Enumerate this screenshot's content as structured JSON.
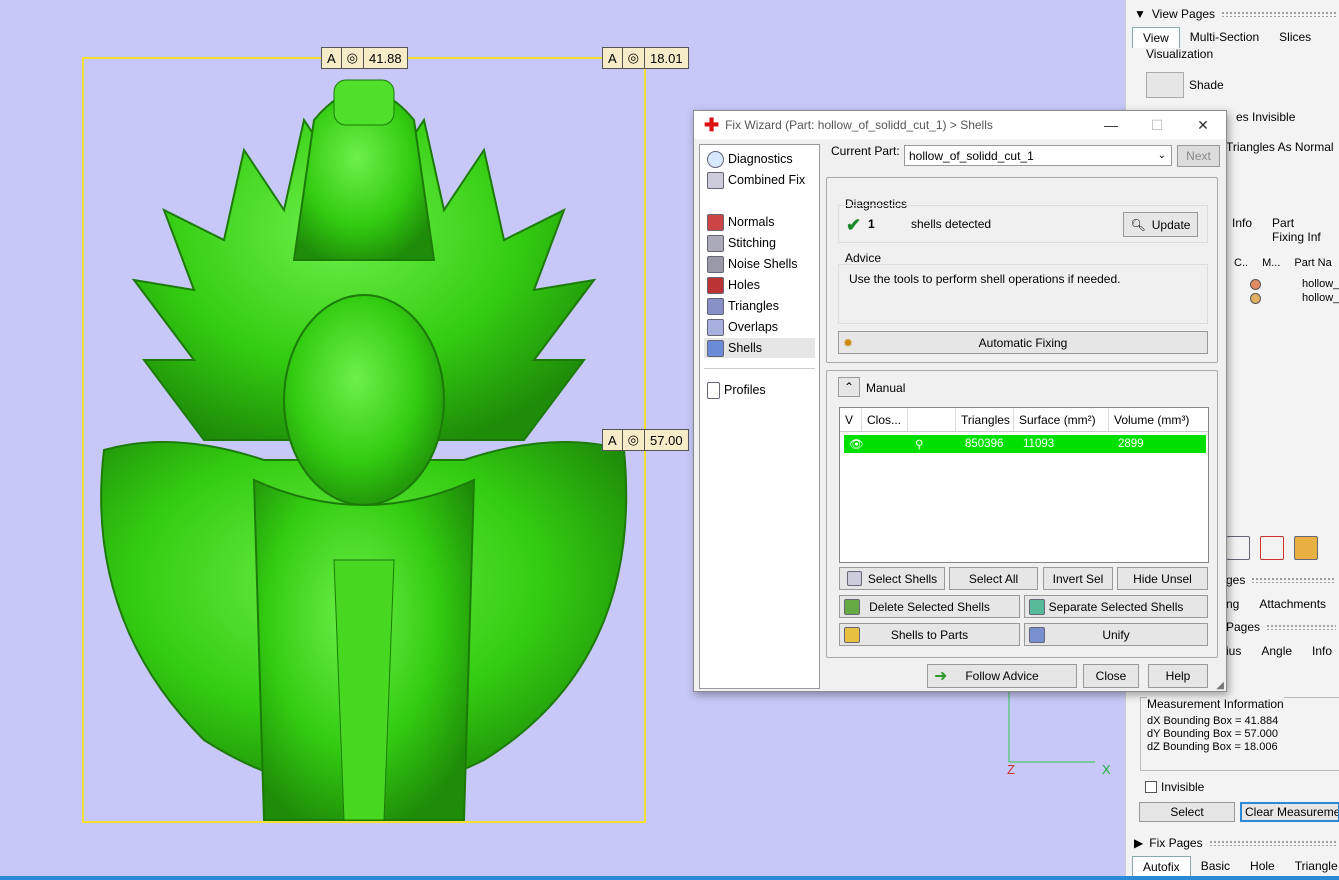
{
  "viewport": {
    "dim_labels": [
      {
        "axis": "A",
        "value": "41.88"
      },
      {
        "axis": "A",
        "value": "18.01"
      },
      {
        "axis": "A",
        "value": "57.00"
      }
    ],
    "axes": {
      "z": "Z",
      "x": "X"
    }
  },
  "right_panel": {
    "view_pages": {
      "title": "View Pages",
      "tabs": [
        "View",
        "Multi-Section",
        "Slices"
      ],
      "visualization_label": "Visualization",
      "shade_label": "Shade",
      "invisible_partial": "es Invisible",
      "triangles_partial": "Triangles As Normal"
    },
    "info_tabs": [
      "Info",
      "Part Fixing Inf"
    ],
    "part_list": {
      "headers": [
        "C..",
        "M...",
        "Part Na"
      ],
      "rows": [
        "hollow_",
        "hollow_"
      ]
    },
    "pages2": {
      "title_partial": "ges",
      "tabs": [
        "ng",
        "Attachments"
      ]
    },
    "measure_pages": {
      "title_partial": "Pages",
      "tabs": [
        "ius",
        "Angle",
        "Info"
      ]
    },
    "measurement": {
      "title": "Measurement Information",
      "lines": [
        "dX Bounding Box = 41.884",
        "dY Bounding Box = 57.000",
        "dZ Bounding Box = 18.006"
      ]
    },
    "invisible_checkbox": "Invisible",
    "select_button": "Select",
    "clear_button": "Clear Measurements",
    "fix_pages": {
      "title": "Fix Pages",
      "tabs": [
        "Autofix",
        "Basic",
        "Hole",
        "Triangle"
      ]
    }
  },
  "dialog": {
    "title": "Fix Wizard (Part: hollow_of_solidd_cut_1) > Shells",
    "nav": {
      "group1": [
        "Diagnostics",
        "Combined Fix"
      ],
      "group2": [
        "Normals",
        "Stitching",
        "Noise Shells",
        "Holes",
        "Triangles",
        "Overlaps",
        "Shells"
      ],
      "group3": [
        "Profiles"
      ],
      "selected": "Shells"
    },
    "current_part_label": "Current Part:",
    "current_part_value": "hollow_of_solidd_cut_1",
    "next_button": "Next",
    "diagnostics": {
      "title": "Diagnostics",
      "count": "1",
      "text": "shells detected",
      "update_button": "Update"
    },
    "advice": {
      "title": "Advice",
      "text": "Use the tools to perform shell operations if needed."
    },
    "automatic_fixing_button": "Automatic Fixing",
    "manual": {
      "title": "Manual",
      "columns": [
        "V",
        "Clos...",
        "",
        "Triangles",
        "Surface (mm²)",
        "Volume (mm³)"
      ],
      "rows": [
        {
          "triangles": "850396",
          "surface": "11093",
          "volume": "2899"
        }
      ]
    },
    "buttons": {
      "select_shells": "Select Shells",
      "select_all": "Select All",
      "invert_sel": "Invert Sel",
      "hide_unsel": "Hide Unsel",
      "delete_selected": "Delete Selected Shells",
      "separate_selected": "Separate Selected Shells",
      "shells_to_parts": "Shells to Parts",
      "unify": "Unify",
      "follow_advice": "Follow Advice",
      "close": "Close",
      "help": "Help"
    }
  },
  "colors": {
    "viewport_bg": "#c8c8f8",
    "model_green": "#33cc11",
    "row_green": "#00e000",
    "bbox": "#f0e030"
  }
}
